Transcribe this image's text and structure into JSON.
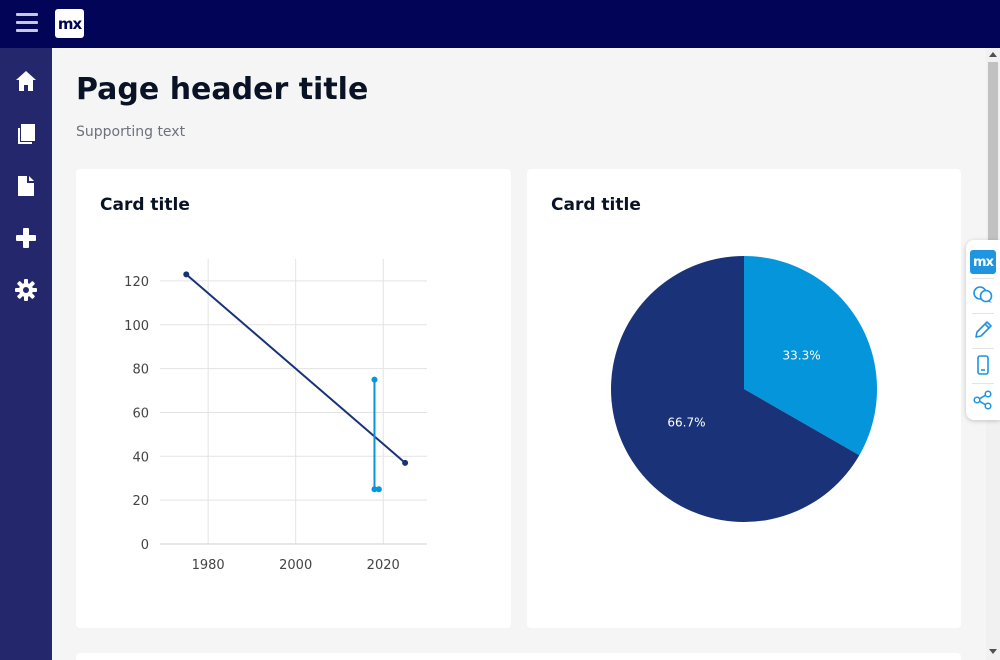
{
  "app": {
    "logo_text": "mx"
  },
  "sidebar": {
    "items": [
      {
        "icon": "home-icon"
      },
      {
        "icon": "book-icon"
      },
      {
        "icon": "document-icon"
      },
      {
        "icon": "plus-icon"
      },
      {
        "icon": "gear-icon"
      }
    ]
  },
  "page": {
    "title": "Page header title",
    "subtitle": "Supporting text"
  },
  "cards": [
    {
      "title": "Card title"
    },
    {
      "title": "Card title"
    }
  ],
  "devtools": {
    "logo_text": "mx",
    "items": [
      "mx-logo-icon",
      "chat-icon",
      "pencil-icon",
      "phone-icon",
      "share-icon"
    ]
  },
  "colors": {
    "topbar": "#020557",
    "sidebar": "#24276c",
    "series_dark": "#1a3277",
    "series_light": "#0595db"
  },
  "chart_data": [
    {
      "type": "line",
      "title": "",
      "xlabel": "",
      "ylabel": "",
      "xlim": [
        1969,
        2030
      ],
      "ylim": [
        0,
        130
      ],
      "x_ticks": [
        1980,
        2000,
        2020
      ],
      "y_ticks": [
        0,
        20,
        40,
        60,
        80,
        100,
        120
      ],
      "grid": true,
      "series": [
        {
          "color": "#1a3277",
          "points": [
            [
              1975,
              123
            ],
            [
              2025,
              37
            ]
          ]
        },
        {
          "color": "#0595db",
          "points": [
            [
              2018,
              75
            ],
            [
              2018,
              25
            ],
            [
              2019,
              25
            ]
          ]
        }
      ]
    },
    {
      "type": "pie",
      "slices": [
        {
          "label": "33.3%",
          "value": 33.3,
          "color": "#0595db"
        },
        {
          "label": "66.7%",
          "value": 66.7,
          "color": "#1a3277"
        }
      ]
    }
  ]
}
